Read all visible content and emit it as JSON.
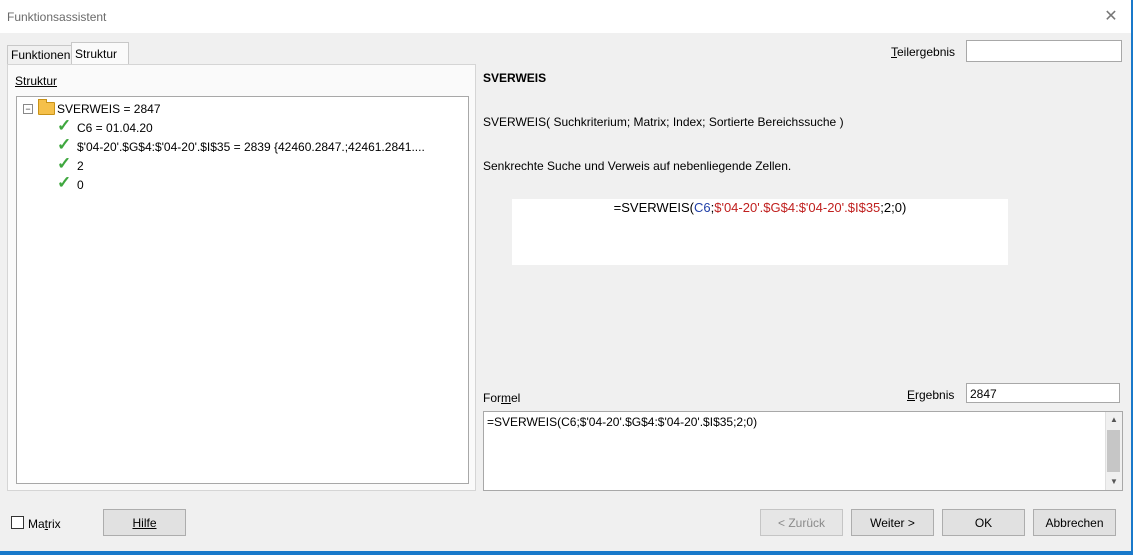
{
  "window": {
    "title": "Funktionsassistent"
  },
  "tabs": [
    {
      "label": "Funktionen"
    },
    {
      "label": "Struktur"
    }
  ],
  "structure": {
    "label": "Struktur",
    "tree": [
      {
        "text": "SVERWEIS = 2847",
        "icon": "folder-open"
      },
      {
        "text": "C6 = 01.04.20",
        "icon": "check-icon"
      },
      {
        "text": "$'04-20'.$G$4:$'04-20'.$I$35 = 2839  {42460.2847.;42461.2841....",
        "icon": "check-icon"
      },
      {
        "text": "2",
        "icon": "check-icon"
      },
      {
        "text": "0",
        "icon": "check-icon"
      }
    ]
  },
  "function": {
    "name": "SVERWEIS",
    "signature": "SVERWEIS( Suchkriterium; Matrix; Index; Sortierte Bereichssuche )",
    "description": "Senkrechte Suche und Verweis auf nebenliegende Zellen.",
    "preview": {
      "prefix": "=SVERWEIS(",
      "arg1": "C6",
      "sep1": ";",
      "arg2": "$'04-20'.$G$4:$'04-20'.$I$35",
      "suffix": ";2;0)"
    }
  },
  "teilergebnis": {
    "label": "Teilergebnis",
    "value": ""
  },
  "formel": {
    "label": "Formel",
    "value": "=SVERWEIS(C6;$'04-20'.$G$4:$'04-20'.$I$35;2;0)"
  },
  "ergebnis": {
    "label": "Ergebnis",
    "value": "2847"
  },
  "matrix": {
    "label": "Matrix",
    "checked": false
  },
  "buttons": {
    "hilfe": "Hilfe",
    "zurueck": "< Zurück",
    "weiter": "Weiter >",
    "ok": "OK",
    "abbrechen": "Abbrechen"
  },
  "colors": {
    "accent": "#1979ca",
    "check": "#3fa73f",
    "ref_blue": "#1f3fa8",
    "ref_red": "#c0201f"
  }
}
